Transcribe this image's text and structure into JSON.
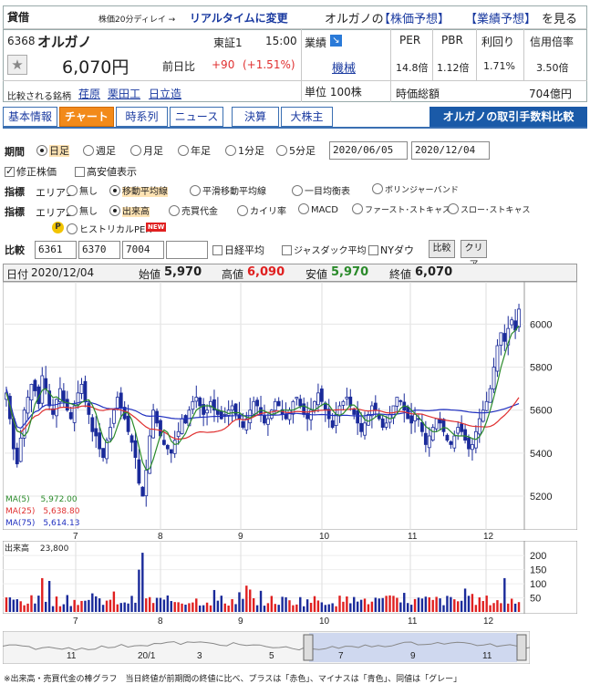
{
  "header": {
    "category": "貸借",
    "delay_note": "株価20分ディレイ →",
    "realtime_link": "リアルタイムに変更",
    "company_prefix": "オルガノの",
    "forecast_link_1": "【株価予想】",
    "forecast_link_2": "【業績予想】",
    "view_text": "を見る"
  },
  "stock": {
    "code": "6368",
    "name": "オルガノ",
    "market": "東証1",
    "time": "15:00",
    "price": "6,070円",
    "prev_label": "前日比",
    "change": "+90",
    "change_pct": "(+1.51%)",
    "compare_label": "比較される銘柄",
    "peers": [
      "荏原",
      "栗田工",
      "日立造"
    ]
  },
  "metrics": {
    "perf_label": "業績",
    "sector": "機械",
    "unit": "単位 100株",
    "per_label": "PER",
    "pbr_label": "PBR",
    "yield_label": "利回り",
    "margin_label": "信用倍率",
    "per": "14.8倍",
    "pbr": "1.12倍",
    "yield": "1.71%",
    "margin": "3.50倍",
    "mcap_label": "時価総額",
    "mcap": "704億円"
  },
  "tabs": [
    "基本情報",
    "チャート",
    "時系列",
    "ニュース",
    "決算",
    "大株主"
  ],
  "fee_banner": "オルガノの取引手数料比較",
  "period": {
    "label": "期間",
    "options": [
      "日足",
      "週足",
      "月足",
      "年足",
      "1分足",
      "5分足"
    ],
    "from": "2020/06/05",
    "to": "2020/12/04",
    "adjusted": "修正株価",
    "highlow": "高安値表示"
  },
  "indicator1": {
    "label": "指標",
    "area": "エリア1",
    "options": [
      "無し",
      "移動平均線",
      "平滑移動平均線",
      "一目均衡表",
      "ボリンジャーバンド"
    ]
  },
  "indicator2": {
    "label": "指標",
    "area": "エリア2",
    "options": [
      "無し",
      "出来高",
      "売買代金",
      "カイリ率",
      "MACD",
      "ファースト･ストキャス",
      "スロー･ストキャス"
    ],
    "extra": "ヒストリカルPER",
    "new_badge": "NEW",
    "p_badge": "P"
  },
  "compare": {
    "label": "比較",
    "codes": [
      "6361",
      "6370",
      "7004",
      ""
    ],
    "nikkei": "日経平均",
    "jasdaq": "ジャスダック平均",
    "ny": "NYダウ",
    "compare_btn": "比較",
    "clear_btn": "クリア"
  },
  "ohlc": {
    "date_label": "日付",
    "date": "2020/12/04",
    "open_label": "始値",
    "open": "5,970",
    "high_label": "高値",
    "high": "6,090",
    "low_label": "安値",
    "low": "5,970",
    "close_label": "終値",
    "close": "6,070"
  },
  "ma": {
    "ma5": "MA(5)　 5,972.00",
    "ma25": "MA(25)　5,638.80",
    "ma75": "MA(75)　5,614.13"
  },
  "volume_label": "出来高　 23,800",
  "footer_note": "※出来高・売買代金の棒グラフ　当日終値が前期間の終値に比べ、プラスは「赤色」、マイナスは「青色」、同値は「グレー」",
  "colors": {
    "up_candle": "#ffffff",
    "down_candle": "#1a2a9a",
    "ma5": "#2a8a2a",
    "ma25": "#e03030",
    "ma75": "#2030c0",
    "vol_up": "#e02020",
    "vol_down": "#1a2a9a",
    "accent_orange": "#f28a1a",
    "banner_blue": "#1a5aa8"
  },
  "chart_data": [
    {
      "type": "candlestick",
      "title": "",
      "x_ticks": [
        "7",
        "8",
        "9",
        "10",
        "11",
        "12"
      ],
      "y_ticks": [
        5200,
        5400,
        5600,
        5800,
        6000
      ],
      "ylim": [
        5060,
        6180
      ],
      "series": [
        {
          "name": "MA(5)",
          "last": 5972.0
        },
        {
          "name": "MA(25)",
          "last": 5638.8
        },
        {
          "name": "MA(75)",
          "last": 5614.13
        }
      ],
      "close": [
        5680,
        5560,
        5420,
        5350,
        5470,
        5600,
        5660,
        5720,
        5690,
        5630,
        5760,
        5700,
        5620,
        5580,
        5650,
        5700,
        5640,
        5600,
        5560,
        5620,
        5680,
        5720,
        5640,
        5580,
        5500,
        5480,
        5420,
        5380,
        5460,
        5520,
        5600,
        5660,
        5610,
        5560,
        5500,
        5450,
        5380,
        5260,
        5200,
        5320,
        5480,
        5600,
        5540,
        5480,
        5440,
        5420,
        5400,
        5460,
        5500,
        5560,
        5540,
        5600,
        5640,
        5660,
        5620,
        5580,
        5600,
        5640,
        5600,
        5580,
        5560,
        5580,
        5600,
        5620,
        5580,
        5560,
        5520,
        5560,
        5600,
        5640,
        5620,
        5580,
        5540,
        5560,
        5600,
        5640,
        5620,
        5580,
        5560,
        5600,
        5640,
        5660,
        5620,
        5580,
        5560,
        5600,
        5640,
        5680,
        5640,
        5600,
        5560,
        5520,
        5580,
        5620,
        5640,
        5660,
        5620,
        5580,
        5540,
        5500,
        5540,
        5580,
        5620,
        5600,
        5560,
        5520,
        5540,
        5580,
        5620,
        5660,
        5640,
        5600,
        5560,
        5540,
        5580,
        5560,
        5500,
        5440,
        5480,
        5520,
        5560,
        5540,
        5500,
        5460,
        5440,
        5480,
        5520,
        5500,
        5460,
        5420,
        5440,
        5500,
        5560,
        5600,
        5640,
        5700,
        5800,
        5900,
        5960,
        5920,
        5980,
        6020,
        5972,
        6070
      ],
      "volume_max": 220
    }
  ]
}
